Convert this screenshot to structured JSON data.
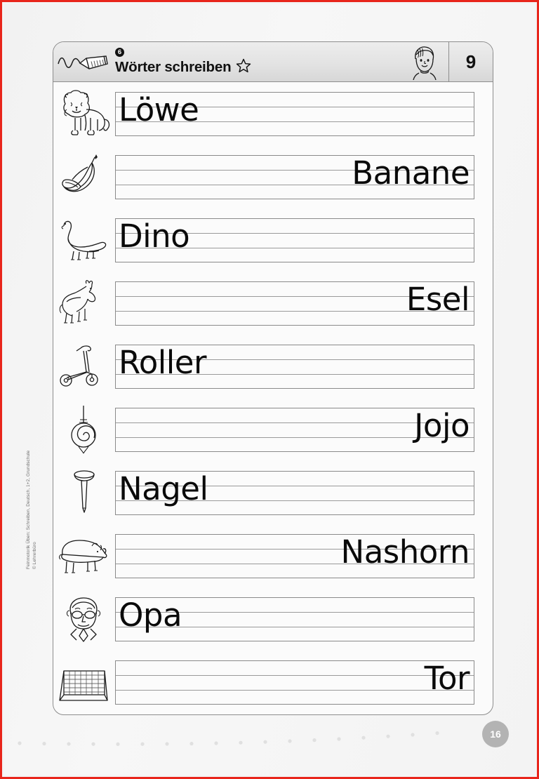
{
  "header": {
    "exercise_number": "6",
    "title": "Wörter schreiben",
    "page_number": "9",
    "pencil_icon": "pencil-drawing-wavy-line-icon",
    "star_icon": "star-outline-icon",
    "face_icon": "boy-face-icon"
  },
  "rows": [
    {
      "icon": "lion-icon",
      "word": "Löwe",
      "align": "left"
    },
    {
      "icon": "banana-icon",
      "word": "Banane",
      "align": "right"
    },
    {
      "icon": "dinosaur-icon",
      "word": "Dino",
      "align": "left"
    },
    {
      "icon": "donkey-icon",
      "word": "Esel",
      "align": "right"
    },
    {
      "icon": "scooter-icon",
      "word": "Roller",
      "align": "left"
    },
    {
      "icon": "yoyo-icon",
      "word": "Jojo",
      "align": "right"
    },
    {
      "icon": "nail-icon",
      "word": "Nagel",
      "align": "left"
    },
    {
      "icon": "rhinoceros-icon",
      "word": "Nashorn",
      "align": "right"
    },
    {
      "icon": "grandfather-icon",
      "word": "Opa",
      "align": "left"
    },
    {
      "icon": "soccer-goal-icon",
      "word": "Tor",
      "align": "right"
    }
  ],
  "copyright": {
    "line1": "Feinmotorik Üben: Schreiben, Deutsch, 1+2, Grundschule",
    "line2": "© Lehrerbüro"
  },
  "footer": {
    "badge_number": "16"
  },
  "colors": {
    "page_border": "#e8251b",
    "header_bar": "#e3e3e3",
    "badge": "#b3b3b3",
    "rule_line": "#8a8a8a",
    "ink": "#0a0a0a"
  }
}
